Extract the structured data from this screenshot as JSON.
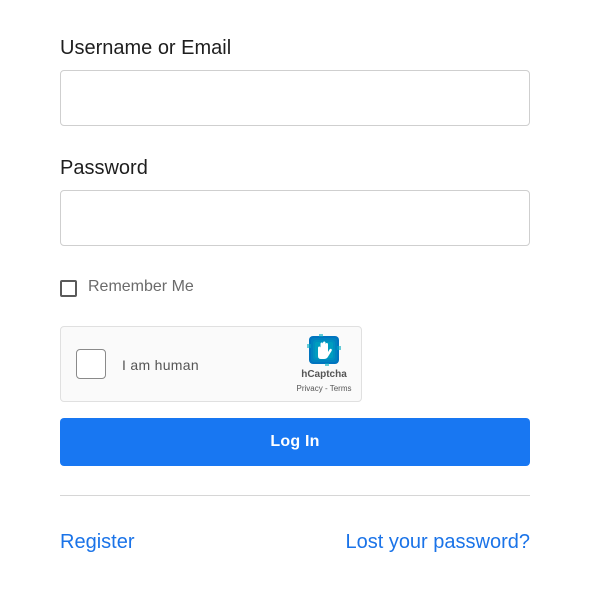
{
  "username": {
    "label": "Username or Email",
    "value": "",
    "placeholder": ""
  },
  "password": {
    "label": "Password",
    "value": "",
    "placeholder": ""
  },
  "remember": {
    "label": "Remember Me",
    "checked": false
  },
  "captcha": {
    "checkbox_label": "I am human",
    "brand": "hCaptcha",
    "privacy_link": "Privacy",
    "separator": "-",
    "terms_link": "Terms",
    "logo_icon": "hcaptcha-hand-icon"
  },
  "login_button": {
    "label": "Log In"
  },
  "links": {
    "register": "Register",
    "lost_password": "Lost your password?"
  },
  "colors": {
    "primary": "#1877f2",
    "link": "#1a73e8",
    "border": "#cfcfcf"
  }
}
